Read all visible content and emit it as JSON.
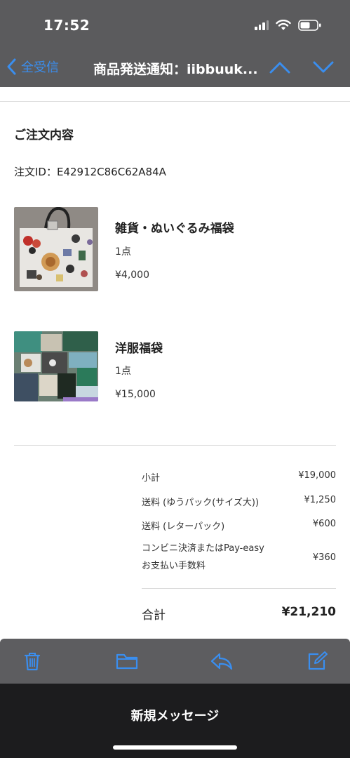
{
  "status": {
    "time": "17:52"
  },
  "nav": {
    "back_label": "全受信",
    "title": "商品発送通知：iibbuuk..."
  },
  "order": {
    "section_title": "ご注文内容",
    "order_id": "注文ID：E42912C86C62A84A",
    "items": [
      {
        "name": "雑貨・ぬいぐるみ福袋",
        "qty": "1点",
        "price": "¥4,000"
      },
      {
        "name": "洋服福袋",
        "qty": "1点",
        "price": "¥15,000"
      }
    ]
  },
  "summary": {
    "rows": [
      {
        "label": "小計",
        "value": "¥19,000"
      },
      {
        "label": "送料 (ゆうパック(サイズ大))",
        "value": "¥1,250"
      },
      {
        "label": "送料 (レターパック)",
        "value": "¥600"
      }
    ],
    "fee": {
      "label_line1": "コンビニ決済またはPay-easy",
      "label_line2": "お支払い手数料",
      "value": "¥360"
    },
    "total": {
      "label": "合計",
      "value": "¥21,210"
    }
  },
  "toolbar": {
    "icons": [
      "trash-icon",
      "folder-icon",
      "reply-icon",
      "compose-icon"
    ]
  },
  "compose": {
    "label": "新規メッセージ"
  },
  "colors": {
    "accent": "#3a8eef",
    "bar": "#5b5b5d",
    "sheet": "#1c1c1e"
  }
}
